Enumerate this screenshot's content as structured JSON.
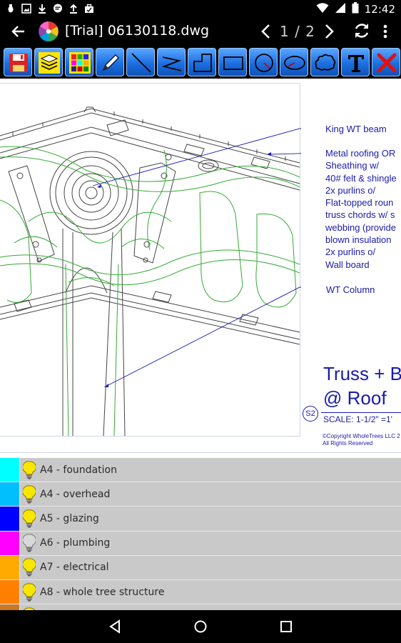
{
  "status_bar": {
    "time": "12:42",
    "left_icons": [
      "bug-icon",
      "image-icon",
      "download-icon",
      "chat-icon",
      "upload-icon",
      "briefcase-icon"
    ],
    "right_icons": [
      "wifi-icon",
      "signal-icon",
      "battery-icon"
    ]
  },
  "app_bar": {
    "title": "[Trial] 06130118.dwg",
    "page_indicator": "1 / 2"
  },
  "toolbar": {
    "tools": [
      "save-tool",
      "layers-tool",
      "colors-tool",
      "pencil-tool",
      "line-tool",
      "polyline-tool",
      "step-tool",
      "rectangle-tool",
      "circle-tool",
      "ellipse-tool",
      "cloud-tool",
      "text-tool",
      "delete-tool"
    ]
  },
  "drawing": {
    "annotations": {
      "king_beam": "King WT beam",
      "roofing": [
        "Metal roofing OR",
        "Sheathing w/",
        "40# felt & shingle",
        "2x purlins o/",
        "Flat-topped roun",
        "truss chords w/ s",
        "webbing (provide",
        "blown insulation",
        "2x purlins o/",
        "Wall board"
      ],
      "wt_column": "WT Column"
    },
    "title_line1": "Truss + B",
    "title_line2": "@ Roof",
    "sheet_tag": "S2",
    "scale": "SCALE: 1-1/2\" =1'",
    "copyright_line1": "©Copyright WholeTrees LLC 2",
    "copyright_line2": "All Rights Reserved"
  },
  "layers": [
    {
      "color": "#00ffff",
      "name": "A4 - foundation",
      "on": true
    },
    {
      "color": "#00bfff",
      "name": "A4 - overhead",
      "on": true
    },
    {
      "color": "#0000ff",
      "name": "A5 - glazing",
      "on": true
    },
    {
      "color": "#ff00ff",
      "name": "A6 - plumbing",
      "on": false
    },
    {
      "color": "#ffaa00",
      "name": "A7 - electrical",
      "on": true
    },
    {
      "color": "#ff7f00",
      "name": "A8 - whole tree structure",
      "on": true
    },
    {
      "color": "#cc7722",
      "name": "",
      "on": true
    }
  ],
  "colors": {
    "toolbar_blue": "#1c6fe0",
    "annotation_blue": "#1a1ab0",
    "drawing_green": "#33aa33",
    "layer_bg": "#c9c9c9"
  }
}
